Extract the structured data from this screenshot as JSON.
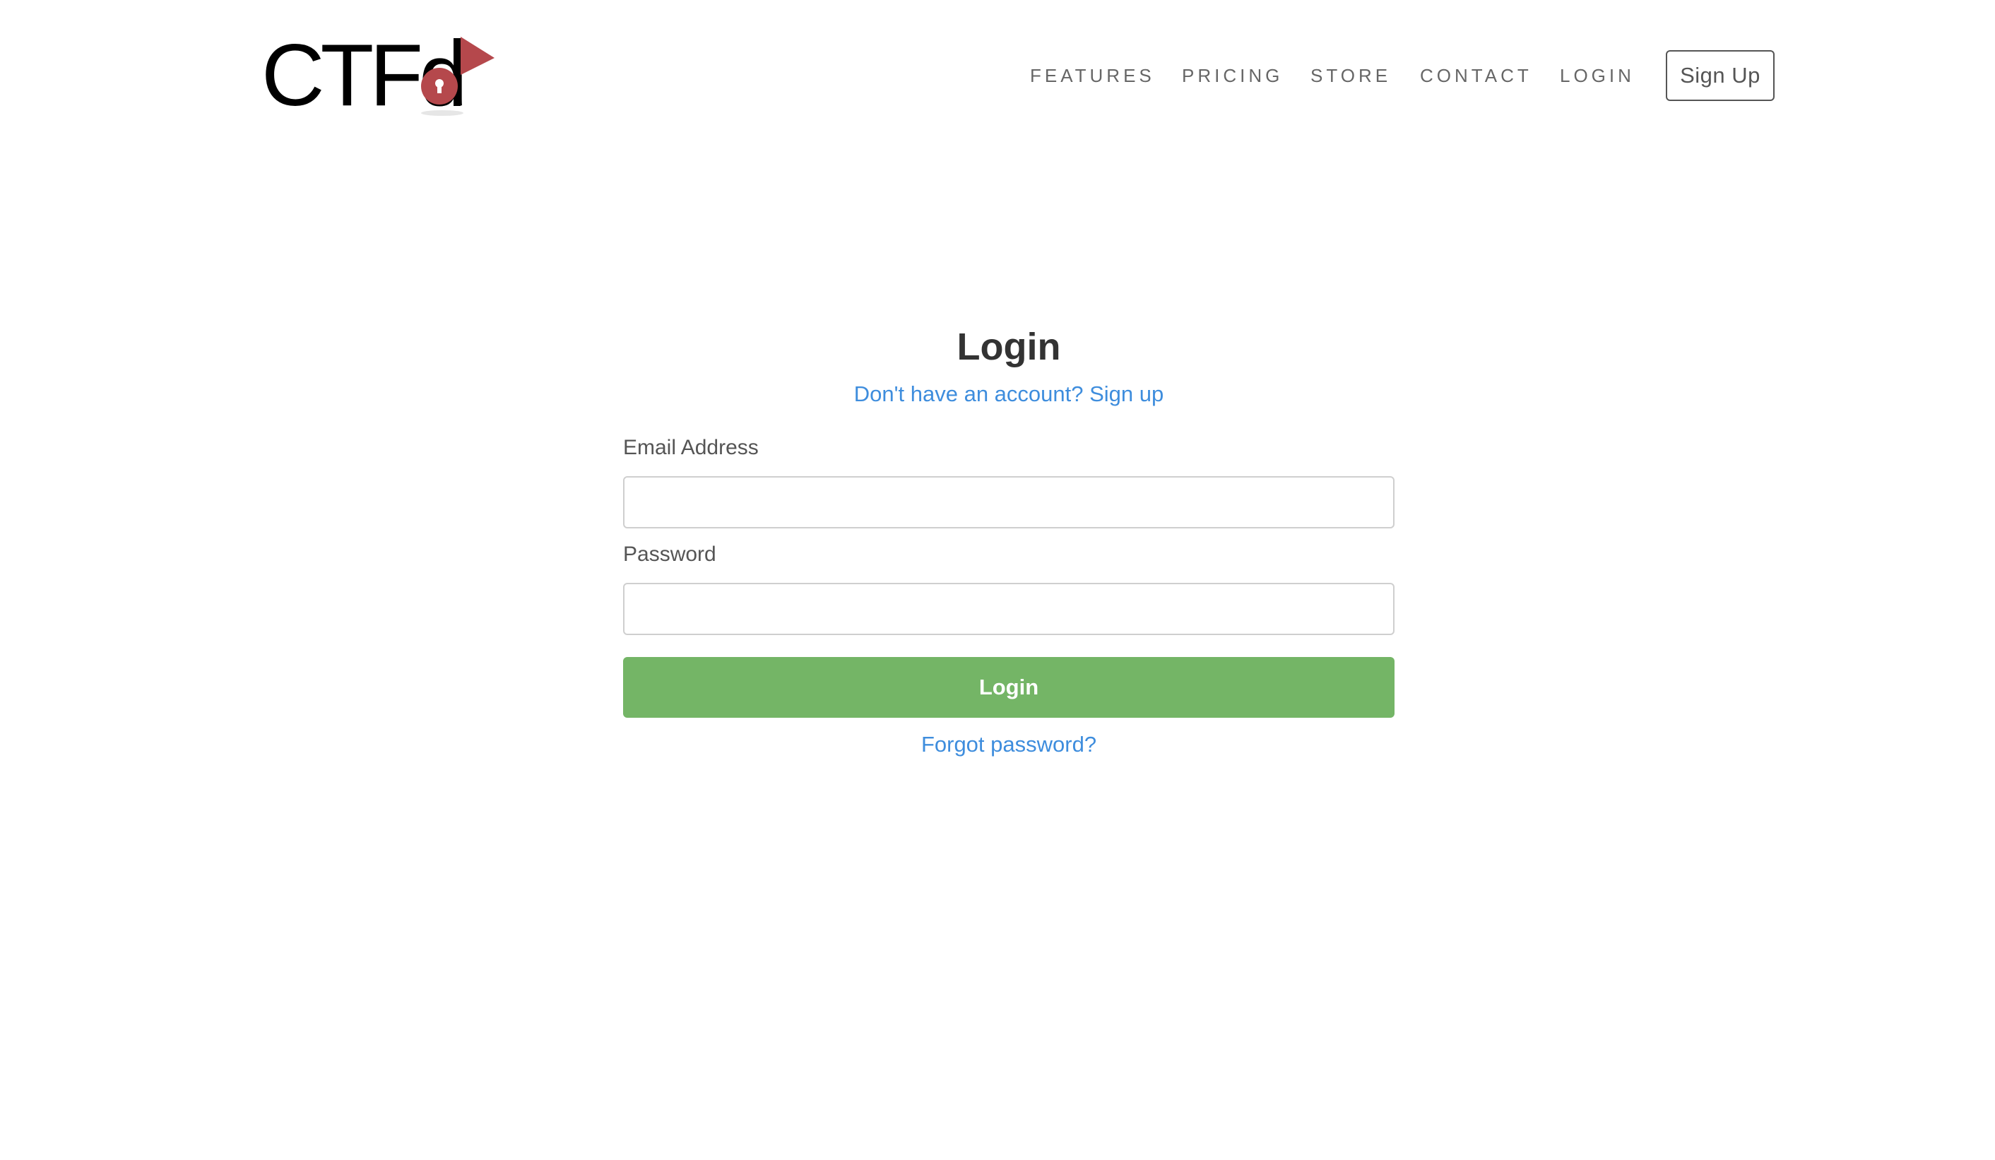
{
  "brand": {
    "logo_text": "CTFd",
    "logo_text_color": "#000000",
    "flag_color": "#b5484c",
    "lock_icon": "padlock-icon"
  },
  "nav": {
    "items": [
      {
        "label": "FEATURES"
      },
      {
        "label": "PRICING"
      },
      {
        "label": "STORE"
      },
      {
        "label": "CONTACT"
      },
      {
        "label": "LOGIN"
      }
    ],
    "signup_label": "Sign Up"
  },
  "login": {
    "title": "Login",
    "signup_prompt": "Don't have an account? Sign up",
    "email_label": "Email Address",
    "email_value": "",
    "password_label": "Password",
    "password_value": "",
    "submit_label": "Login",
    "forgot_label": "Forgot password?"
  },
  "colors": {
    "link": "#3e8ddd",
    "primary_button": "#74b566",
    "nav_text": "#666666",
    "heading": "#333333"
  }
}
